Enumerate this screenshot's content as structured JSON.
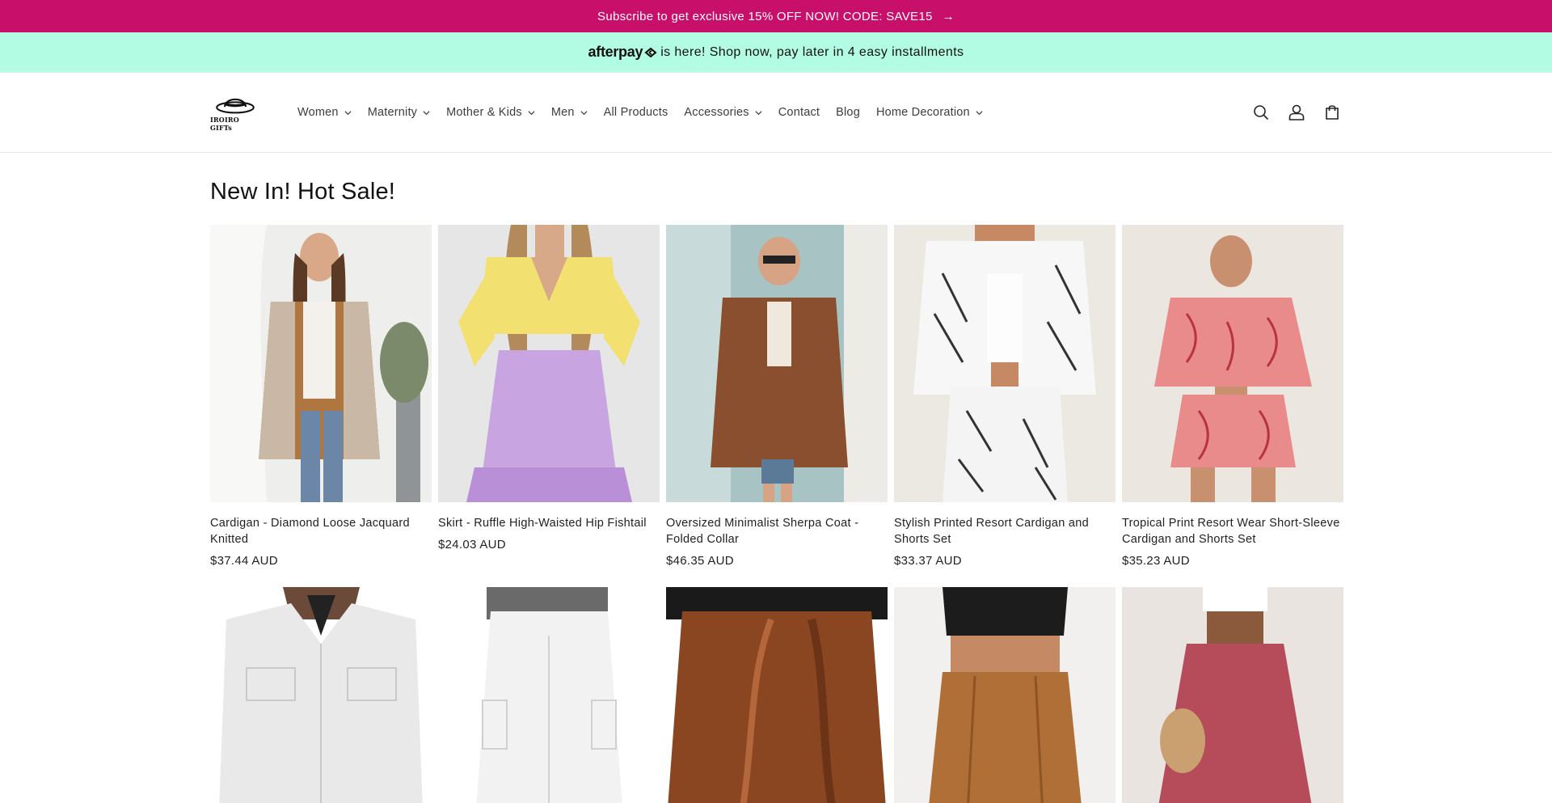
{
  "promo": {
    "text": "Subscribe to get exclusive 15% OFF NOW! CODE: SAVE15",
    "arrow": "→",
    "bg": "#c8106b"
  },
  "afterpay": {
    "logo": "afterpay",
    "text": "is here! Shop now, pay later in 4 easy installments",
    "bg": "#b2fce4"
  },
  "header": {
    "logo_text": "IROIRO GIFTs",
    "nav": [
      {
        "label": "Women",
        "dropdown": true
      },
      {
        "label": "Maternity",
        "dropdown": true
      },
      {
        "label": "Mother & Kids",
        "dropdown": true
      },
      {
        "label": "Men",
        "dropdown": true
      },
      {
        "label": "All Products",
        "dropdown": false
      },
      {
        "label": "Accessories",
        "dropdown": true
      },
      {
        "label": "Contact",
        "dropdown": false
      },
      {
        "label": "Blog",
        "dropdown": false
      },
      {
        "label": "Home Decoration",
        "dropdown": true
      }
    ],
    "icons": [
      "search-icon",
      "account-icon",
      "cart-icon"
    ]
  },
  "main": {
    "section_title": "New In! Hot Sale!",
    "products": [
      {
        "title": "Cardigan - Diamond Loose Jacquard Knitted",
        "price": "$37.44 AUD"
      },
      {
        "title": "Skirt - Ruffle High-Waisted Hip Fishtail",
        "price": "$24.03 AUD"
      },
      {
        "title": "Oversized Minimalist Sherpa Coat - Folded Collar",
        "price": "$46.35 AUD"
      },
      {
        "title": "Stylish Printed Resort Cardigan and Shorts Set",
        "price": "$33.37 AUD"
      },
      {
        "title": "Tropical Print Resort Wear Short-Sleeve Cardigan and Shorts Set",
        "price": "$35.23 AUD"
      }
    ]
  }
}
